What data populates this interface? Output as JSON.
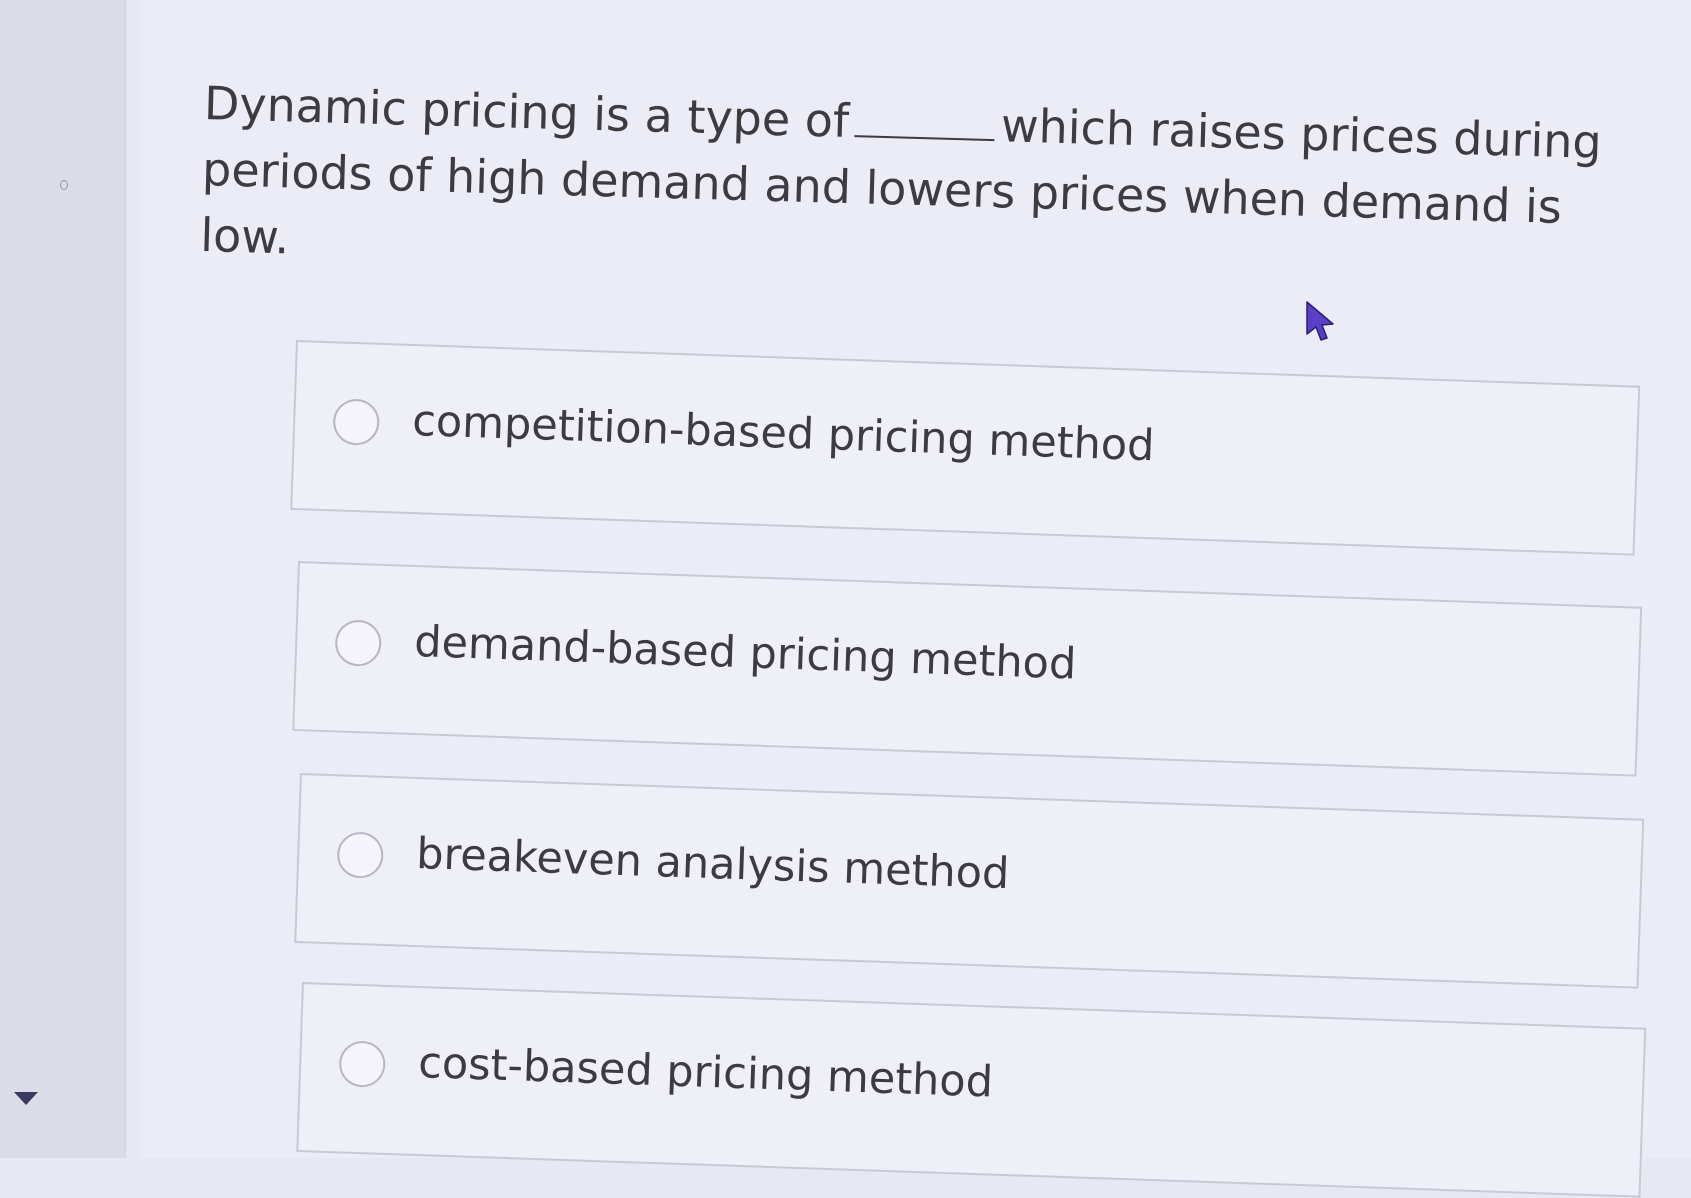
{
  "question": {
    "text_before_blank": "Dynamic pricing is a type of",
    "text_after_blank": "which raises prices during periods of high demand and lowers prices when demand is low."
  },
  "options": [
    {
      "label": "competition-based pricing method",
      "selected": false
    },
    {
      "label": "demand-based pricing method",
      "selected": false
    },
    {
      "label": "breakeven analysis method",
      "selected": false
    },
    {
      "label": "cost-based pricing method",
      "selected": false
    }
  ],
  "colors": {
    "background": "#ececf6",
    "text": "#3b3b40",
    "border": "#c9c9d6",
    "cursor": "#5b3fc4"
  },
  "icons": {
    "cursor": "mouse-pointer-icon",
    "sidebar_toggle": "caret-down-icon"
  }
}
